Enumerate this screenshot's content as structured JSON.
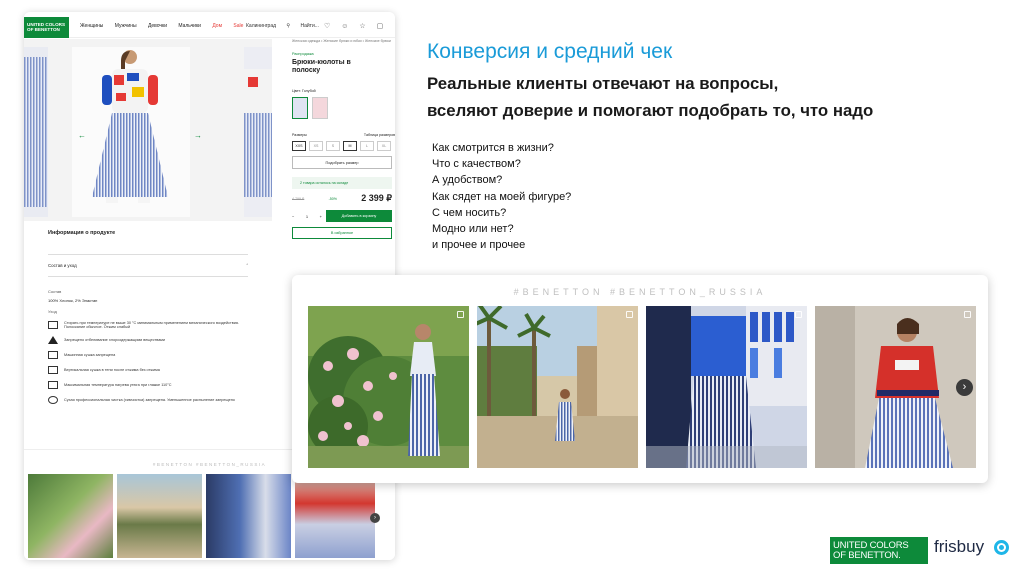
{
  "slide": {
    "title": "Конверсия и средний чек",
    "subtitle_line1": "Реальные клиенты отвечают на вопросы,",
    "subtitle_line2": "вселяют доверие и помогают подобрать то, что надо",
    "questions": [
      "Как смотрится в жизни?",
      "Что с качеством?",
      "А удобством?",
      "Как сядет на моей фигуре?",
      "С чем носить?",
      "Модно или нет?",
      "и прочее и прочее"
    ]
  },
  "widget": {
    "hashtags": "#BENETTON #BENETTON_RUSSIA",
    "next_icon": "chevron-right-icon",
    "photos": [
      {
        "label": "woman-by-rose-bush"
      },
      {
        "label": "woman-on-palm-street"
      },
      {
        "label": "woman-in-store-fitting"
      },
      {
        "label": "woman-in-red-hoodie"
      }
    ]
  },
  "product_page": {
    "logo_line1": "UNITED COLORS",
    "logo_line2": "OF BENETTON",
    "nav": [
      "Женщины",
      "Мужчины",
      "Девочки",
      "Мальчики",
      "Дом",
      "Sale"
    ],
    "city": "Калининград",
    "search": "Найти...",
    "breadcrumb": "Женская одежда • Женские брюки и юбки • Женские брюки",
    "brand": "Распродажа",
    "product_title_line1": "Брюки-кюлоты в",
    "product_title_line2": "полоску",
    "color_label": "Цвет: Голубой",
    "sizes_label": "Размеры",
    "size_chart": "Таблица размеров",
    "sizes": [
      "XXS",
      "XS",
      "S",
      "M",
      "L",
      "XL"
    ],
    "pick_size": "Подобрать размер",
    "stock": "2 товара осталось на складе",
    "old_price": "4 799 ₽",
    "discount": "-50%",
    "price": "2 399 ₽",
    "qty": "1",
    "add_to_cart": "Добавить в корзину",
    "favorites": "В избранное",
    "info_title": "Информация о продукте",
    "composition_row": "Состав и уход",
    "composition_label": "Состав",
    "composition_value": "100% Хлопок, 2% Эластан",
    "care_label": "Уход",
    "care": [
      "Стирать при температуре не выше 30 °С минимальным применением механического воздействия. Полоскание обычное. Отжим слабый",
      "Запрещено отбеливание хлорсодержащими веществами",
      "Машинная сушка запрещена",
      "Вертикальная сушка в тени после отжима без отжима",
      "Максимальная температура нагрева утюга при глажке 110°С",
      "Сухая профессиональная чистка (химчистка) запрещена. Уменьшенное распыление запрещено"
    ],
    "strip_hashtags": "#BENETTON #BENETTON_RUSSIA"
  },
  "footer": {
    "ucb_line1": "UNITED COLORS",
    "ucb_line2": "OF BENETTON.",
    "frisbuy": "frisbuy"
  }
}
